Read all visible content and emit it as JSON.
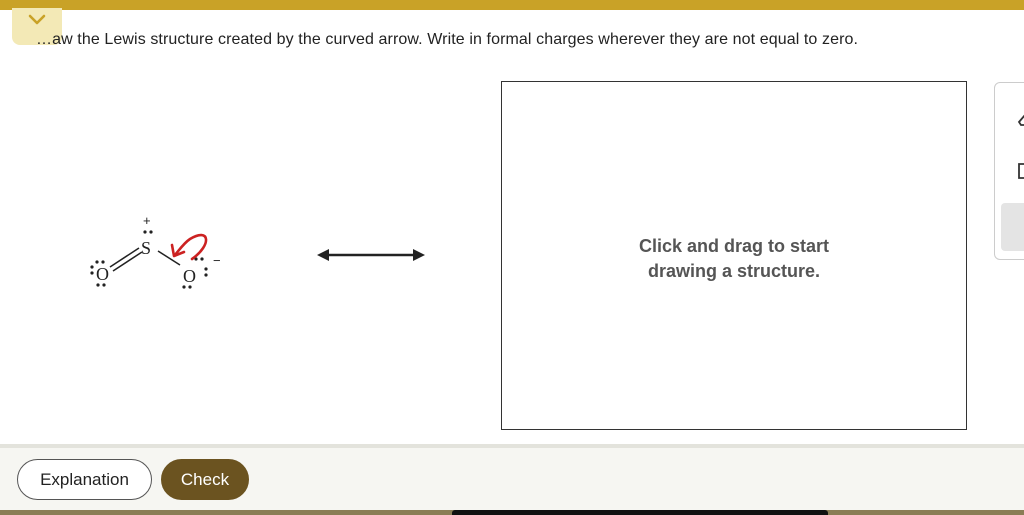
{
  "prompt": "Draw the Lewis structure created by the curved arrow. Write in formal charges wherever they are not equal to zero.",
  "prompt_visible": "…aw the Lewis structure created by the curved arrow. Write in formal charges wherever they are not equal to zero.",
  "molecule": {
    "atoms": [
      "O",
      "S",
      "O"
    ],
    "charge_S": "+",
    "charge_O": "−"
  },
  "canvas": {
    "hint_line1": "Click and drag to start",
    "hint_line2": "drawing a structure."
  },
  "buttons": {
    "explanation": "Explanation",
    "check": "Check"
  },
  "colors": {
    "accent_gold": "#c9a227",
    "check_brown": "#6b5320",
    "curved_arrow_red": "#cc2222"
  },
  "icons": [
    "chevron-down-icon",
    "resonance-arrow-icon",
    "curved-arrow-icon",
    "eraser-icon",
    "bracket-icon"
  ]
}
